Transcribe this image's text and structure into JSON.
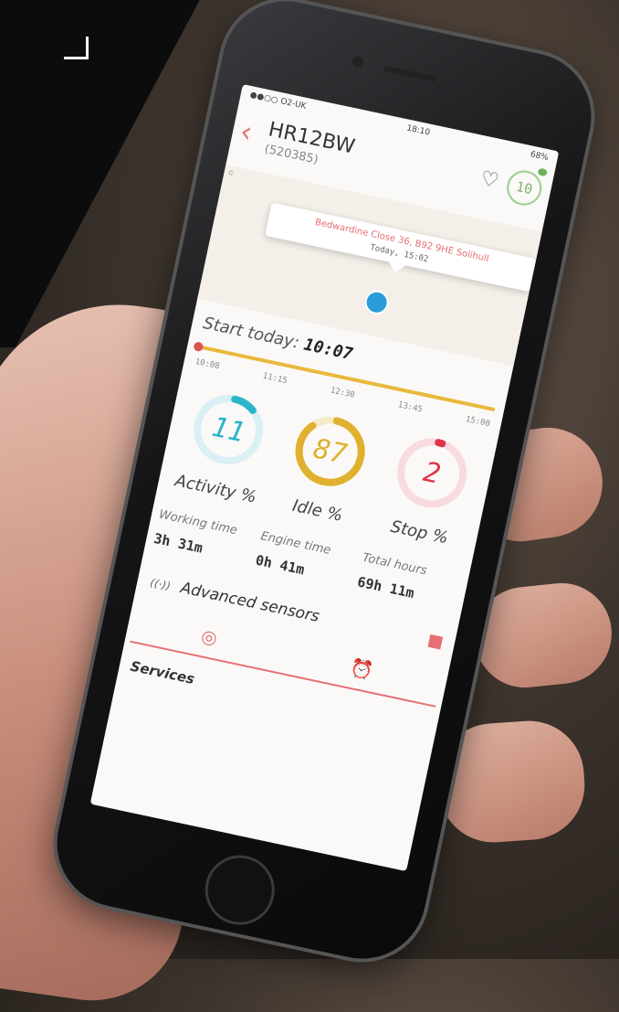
{
  "status_bar": {
    "carrier": "●●○○ O2-UK",
    "time": "18:10",
    "battery": "68%"
  },
  "header": {
    "title": "HR12BW",
    "subtitle": "(520385)",
    "badge_count": "10"
  },
  "map": {
    "label": "©",
    "popup_address": "Bedwardine Close 36, B92 9HE Solihull",
    "popup_time": "Today, 15:02"
  },
  "start": {
    "label": "Start today:",
    "time": "10:07"
  },
  "timeline": {
    "ticks": [
      "10:08",
      "11:15",
      "12:30",
      "13:45",
      "15:00"
    ]
  },
  "gauges": [
    {
      "label": "Activity %",
      "value": "11",
      "percent": 11,
      "color": "#2ab6c9",
      "track": "#d9f0f4"
    },
    {
      "label": "Idle %",
      "value": "87",
      "percent": 87,
      "color": "#e0b12e",
      "track": "#f6ebc9"
    },
    {
      "label": "Stop %",
      "value": "2",
      "percent": 2,
      "color": "#e0344a",
      "track": "#f8dbe0"
    }
  ],
  "stats": [
    {
      "label": "Working time",
      "value": "3h 31m"
    },
    {
      "label": "Engine time",
      "value": "0h 41m"
    },
    {
      "label": "Total hours",
      "value": "69h 11m"
    }
  ],
  "sensors": {
    "label": "Advanced sensors"
  },
  "section": {
    "title": "Services"
  }
}
